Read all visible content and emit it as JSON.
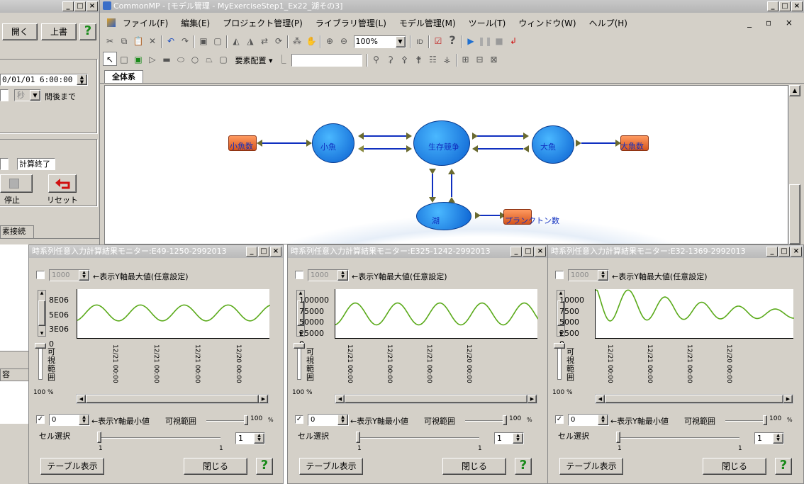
{
  "left_panel": {
    "open_label": "開く",
    "overwrite_label": "上書",
    "help_label": "?",
    "datetime_value": "0/01/01  6:00:00",
    "unit_value": "秒",
    "until_label": "間後まで",
    "status_value": "計算終了",
    "stop_label": "停止",
    "reset_label": "リセット",
    "tab_label": "素接続",
    "lower_label": "容"
  },
  "main_window": {
    "title": "CommonMP - [モデル管理 - MyExerciseStep1_Ex22_湖その3]",
    "menu": [
      "ファイル(F)",
      "編集(E)",
      "プロジェクト管理(P)",
      "ライブラリ管理(L)",
      "モデル管理(M)",
      "ツール(T)",
      "ウィンドウ(W)",
      "ヘルプ(H)"
    ],
    "zoom_value": "100%",
    "arrange_label": "要素配置",
    "tab_label": "全体系"
  },
  "diagram": {
    "nodes": {
      "small_fish_count": "小魚数",
      "small_fish": "小魚",
      "competition": "生存競争",
      "big_fish": "大魚",
      "big_fish_count": "大魚数",
      "lake": "湖",
      "plankton_count": "プランクトン数"
    }
  },
  "monitors": [
    {
      "title": "時系列任意入力計算結果モニター:E49-1250-2992013",
      "max_value": "1000",
      "max_label": "←表示Y軸最大値(任意設定)",
      "y_ticks": [
        "8E06",
        "5E06",
        "3E06",
        "0"
      ],
      "x_ticks": [
        "12/21 00:00",
        "12/21 00:00",
        "12/21 00:00",
        "12/20 00:00"
      ],
      "visible_label": "可視範囲",
      "pct_label": "100 %",
      "min_value": "0",
      "min_label": "←表示Y軸最小値",
      "visible_range_label": "可視範囲",
      "pct_right": "100",
      "pct_unit": "%",
      "cell_label": "セル選択",
      "cell_value": "1",
      "one_a": "1",
      "one_b": "1",
      "table_label": "テーブル表示",
      "close_label": "閉じる",
      "help_label": "?"
    },
    {
      "title": "時系列任意入力計算結果モニター:E325-1242-2992013",
      "max_value": "1000",
      "max_label": "←表示Y軸最大値(任意設定)",
      "y_ticks": [
        "100000",
        "75000",
        "50000",
        "25000",
        "0"
      ],
      "x_ticks": [
        "12/21 00:00",
        "12/21 00:00",
        "12/21 00:00",
        "12/20 00:00"
      ],
      "visible_label": "可視範囲",
      "pct_label": "100 %",
      "min_value": "0",
      "min_label": "←表示Y軸最小値",
      "visible_range_label": "可視範囲",
      "pct_right": "100",
      "pct_unit": "%",
      "cell_label": "セル選択",
      "cell_value": "1",
      "one_a": "1",
      "one_b": "1",
      "table_label": "テーブル表示",
      "close_label": "閉じる",
      "help_label": "?"
    },
    {
      "title": "時系列任意入力計算結果モニター:E32-1369-2992013",
      "max_value": "1000",
      "max_label": "←表示Y軸最大値(任意設定)",
      "y_ticks": [
        "10000",
        "7500",
        "5000",
        "2500",
        "0"
      ],
      "x_ticks": [
        "12/21 00:00",
        "12/21 00:00",
        "12/21 00:00",
        "12/20 00:00"
      ],
      "visible_label": "可視範囲",
      "pct_label": "100 %",
      "min_value": "0",
      "min_label": "←表示Y軸最小値",
      "visible_range_label": "可視範囲",
      "pct_right": "100",
      "pct_unit": "%",
      "cell_label": "セル選択",
      "cell_value": "1",
      "one_a": "1",
      "one_b": "1",
      "table_label": "テーブル表示",
      "close_label": "閉じる",
      "help_label": "?"
    }
  ],
  "colors": {
    "plot_line": "#5aaa1a",
    "node_blue": "#1a7ae0",
    "link_blue": "#1030c0",
    "help_green": "#1a8a1a"
  }
}
